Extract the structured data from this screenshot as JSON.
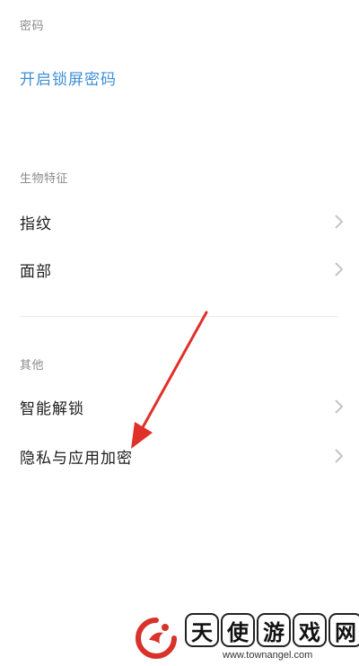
{
  "password_section": {
    "header": "密码",
    "enable_lock_password": "开启锁屏密码"
  },
  "biometric_section": {
    "header": "生物特征",
    "items": [
      {
        "label": "指纹"
      },
      {
        "label": "面部"
      }
    ]
  },
  "other_section": {
    "header": "其他",
    "items": [
      {
        "label": "智能解锁"
      },
      {
        "label": "隐私与应用加密"
      }
    ]
  },
  "watermark": {
    "chars": [
      "天",
      "使",
      "游",
      "戏",
      "网"
    ],
    "url": "www.townangel.com"
  },
  "colors": {
    "link": "#3f8ed6",
    "arrow": "#e0302a",
    "logo": "#d8322b"
  }
}
